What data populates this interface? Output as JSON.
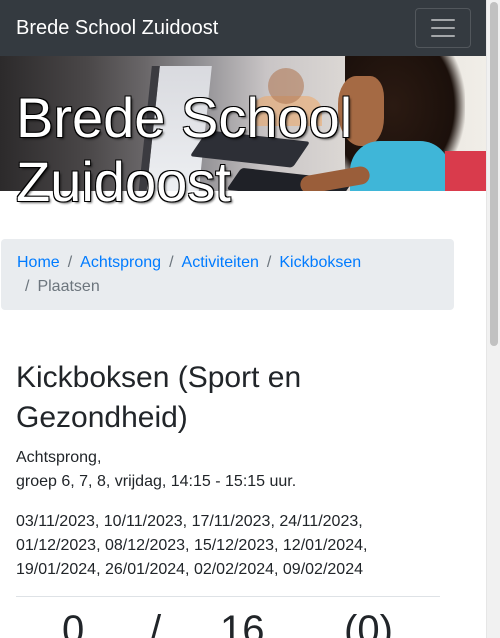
{
  "navbar": {
    "brand": "Brede School Zuidoost",
    "toggler_icon": "hamburger-menu-icon"
  },
  "hero": {
    "title": "Brede School Zuidoost"
  },
  "breadcrumb": {
    "items": [
      "Home",
      "Achtsprong",
      "Activiteiten",
      "Kickboksen"
    ],
    "current": "Plaatsen"
  },
  "activity": {
    "title": "Kickboksen (Sport en Gezondheid)",
    "location": "Achtsprong,",
    "schedule": "groep 6, 7, 8, vrijdag, 14:15 - 15:15 uur.",
    "dates": "03/11/2023, 10/11/2023, 17/11/2023, 24/11/2023, 01/12/2023, 08/12/2023, 15/12/2023, 12/01/2024, 19/01/2024, 26/01/2024, 02/02/2024, 09/02/2024"
  },
  "places": {
    "taken": "0",
    "separator": "/",
    "total": "16",
    "waiting": "(0)"
  },
  "colors": {
    "navbar": "#343a40",
    "link": "#007bff",
    "breadcrumb_bg": "#e9ecef"
  }
}
